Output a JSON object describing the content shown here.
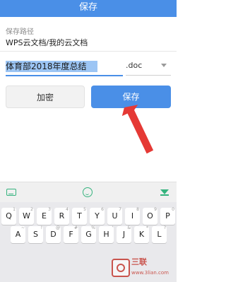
{
  "header": {
    "title": "保存"
  },
  "path": {
    "label": "保存路径",
    "value": "WPS云文档/我的云文档"
  },
  "filename": {
    "value": "体育部2018年度总结",
    "extension": ".doc"
  },
  "buttons": {
    "encrypt_label": "加密",
    "save_label": "保存"
  },
  "keyboard": {
    "rows": [
      [
        {
          "k": "Q",
          "h": "1"
        },
        {
          "k": "W",
          "h": "2"
        },
        {
          "k": "E",
          "h": "3"
        },
        {
          "k": "R",
          "h": "4"
        },
        {
          "k": "T",
          "h": "5"
        },
        {
          "k": "Y",
          "h": "6"
        },
        {
          "k": "U",
          "h": "7"
        },
        {
          "k": "I",
          "h": "8"
        },
        {
          "k": "O",
          "h": "9"
        },
        {
          "k": "P",
          "h": "0"
        }
      ],
      [
        {
          "k": "A",
          "h": "~"
        },
        {
          "k": "S",
          "h": "!"
        },
        {
          "k": "D",
          "h": "@"
        },
        {
          "k": "F",
          "h": "#"
        },
        {
          "k": "G",
          "h": "%"
        },
        {
          "k": "H",
          "h": "'"
        },
        {
          "k": "J",
          "h": "&"
        },
        {
          "k": "K",
          "h": "*"
        },
        {
          "k": "L",
          "h": "?"
        }
      ]
    ]
  },
  "watermark": {
    "text": "三联",
    "sub": "www.3lian.com"
  },
  "colors": {
    "accent": "#4a8fe7",
    "keyboard_accent": "#35b37e",
    "arrow": "#e53935"
  }
}
